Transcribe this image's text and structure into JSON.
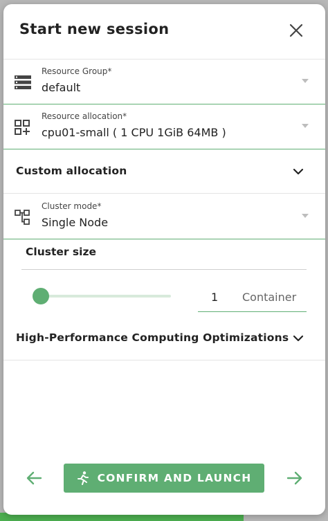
{
  "dialog": {
    "title": "Start new session",
    "close_icon": "close-icon"
  },
  "fields": {
    "resource_group": {
      "label": "Resource Group*",
      "value": "default",
      "icon": "list-icon"
    },
    "resource_allocation": {
      "label": "Resource allocation*",
      "value": "cpu01-small ( 1 CPU 1GiB 64MB )",
      "icon": "grid-plus-icon"
    },
    "cluster_mode": {
      "label": "Cluster mode*",
      "value": "Single Node",
      "icon": "hierarchy-icon"
    }
  },
  "sections": {
    "custom_allocation": "Custom allocation",
    "hpc": "High-Performance Computing Optimizations"
  },
  "cluster_size": {
    "label": "Cluster size",
    "value": "1",
    "unit": "Container",
    "slider_fraction": 0.0
  },
  "footer": {
    "confirm_label": "CONFIRM AND LAUNCH",
    "prev_icon": "arrow-left-icon",
    "next_icon": "arrow-right-icon",
    "run_icon": "running-person-icon"
  },
  "colors": {
    "accent": "#5fae73",
    "text": "#222222"
  }
}
